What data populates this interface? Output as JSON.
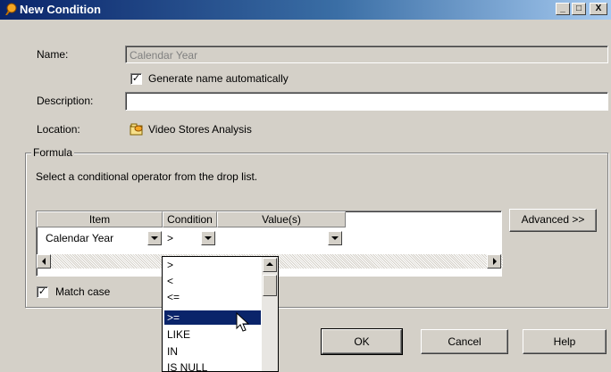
{
  "window": {
    "title": "New Condition",
    "minimize_label": "_",
    "maximize_label": "□",
    "close_label": "X"
  },
  "form": {
    "name_label": "Name:",
    "name_value": "Calendar Year",
    "generate_checkbox_label": "Generate name automatically",
    "generate_checked": true,
    "description_label": "Description:",
    "description_value": "",
    "location_label": "Location:",
    "location_value": "Video Stores Analysis"
  },
  "formula": {
    "group_label": "Formula",
    "instruction": "Select a conditional operator from the drop list.",
    "columns": [
      "Item",
      "Condition",
      "Value(s)"
    ],
    "row": {
      "item": "Calendar Year",
      "condition": ">",
      "values": ""
    },
    "advanced_label": "Advanced >>",
    "match_case_label": "Match case",
    "match_case_checked": true
  },
  "operator_droplist": {
    "items": [
      ">",
      "<",
      "<=",
      ">=",
      "LIKE",
      "IN",
      "IS NULL"
    ],
    "selected": ">="
  },
  "buttons": {
    "ok": "OK",
    "cancel": "Cancel",
    "help": "Help"
  },
  "icons": {
    "title": "condition-icon",
    "location": "folder-icon"
  }
}
